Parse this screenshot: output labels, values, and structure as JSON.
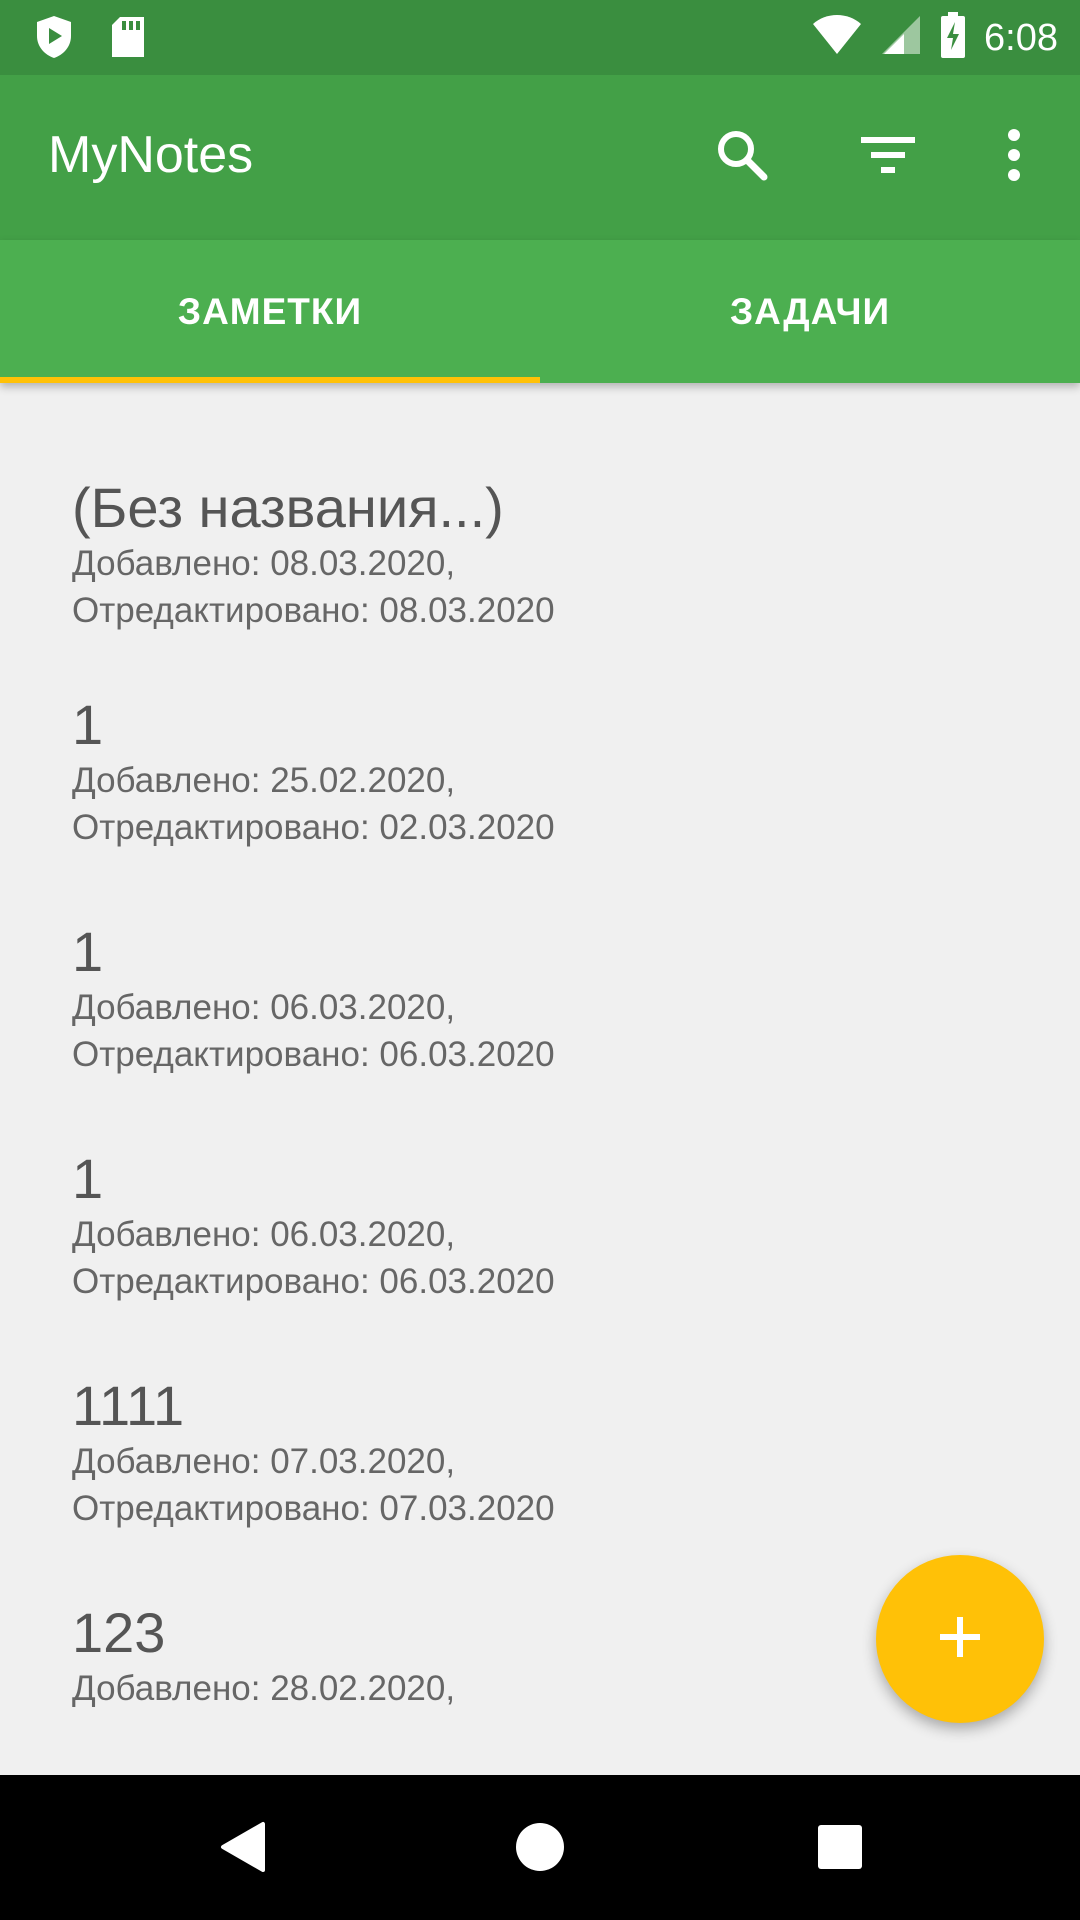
{
  "status_bar": {
    "time": "6:08",
    "icons": [
      "play-protect-icon",
      "sd-card-icon",
      "wifi-icon",
      "signal-icon",
      "battery-charging-icon"
    ]
  },
  "app_bar": {
    "title": "MyNotes",
    "actions": [
      "search-icon",
      "filter-icon",
      "more-vert-icon"
    ]
  },
  "tabs": [
    {
      "label": "ЗАМЕТКИ",
      "selected": true
    },
    {
      "label": "ЗАДАЧИ",
      "selected": false
    }
  ],
  "notes": [
    {
      "title": "(Без названия...)",
      "added": "Добавлено: 08.03.2020,",
      "edited": "Отредактировано: 08.03.2020"
    },
    {
      "title": "1",
      "added": "Добавлено: 25.02.2020,",
      "edited": "Отредактировано: 02.03.2020"
    },
    {
      "title": "1",
      "added": "Добавлено: 06.03.2020,",
      "edited": "Отредактировано: 06.03.2020"
    },
    {
      "title": "1",
      "added": "Добавлено: 06.03.2020,",
      "edited": "Отредактировано: 06.03.2020"
    },
    {
      "title": "1111",
      "added": "Добавлено: 07.03.2020,",
      "edited": "Отредактировано: 07.03.2020"
    },
    {
      "title": "123",
      "added": "Добавлено: 28.02.2020,",
      "edited": ""
    }
  ],
  "fab": {
    "icon": "add-icon"
  },
  "nav_bar": {
    "buttons": [
      "back-icon",
      "home-icon",
      "recents-icon"
    ]
  },
  "colors": {
    "status_bar": "#3a8e3f",
    "app_bar": "#43a047",
    "tabs": "#4caf50",
    "accent": "#ffc107",
    "background": "#f0f0f0"
  }
}
